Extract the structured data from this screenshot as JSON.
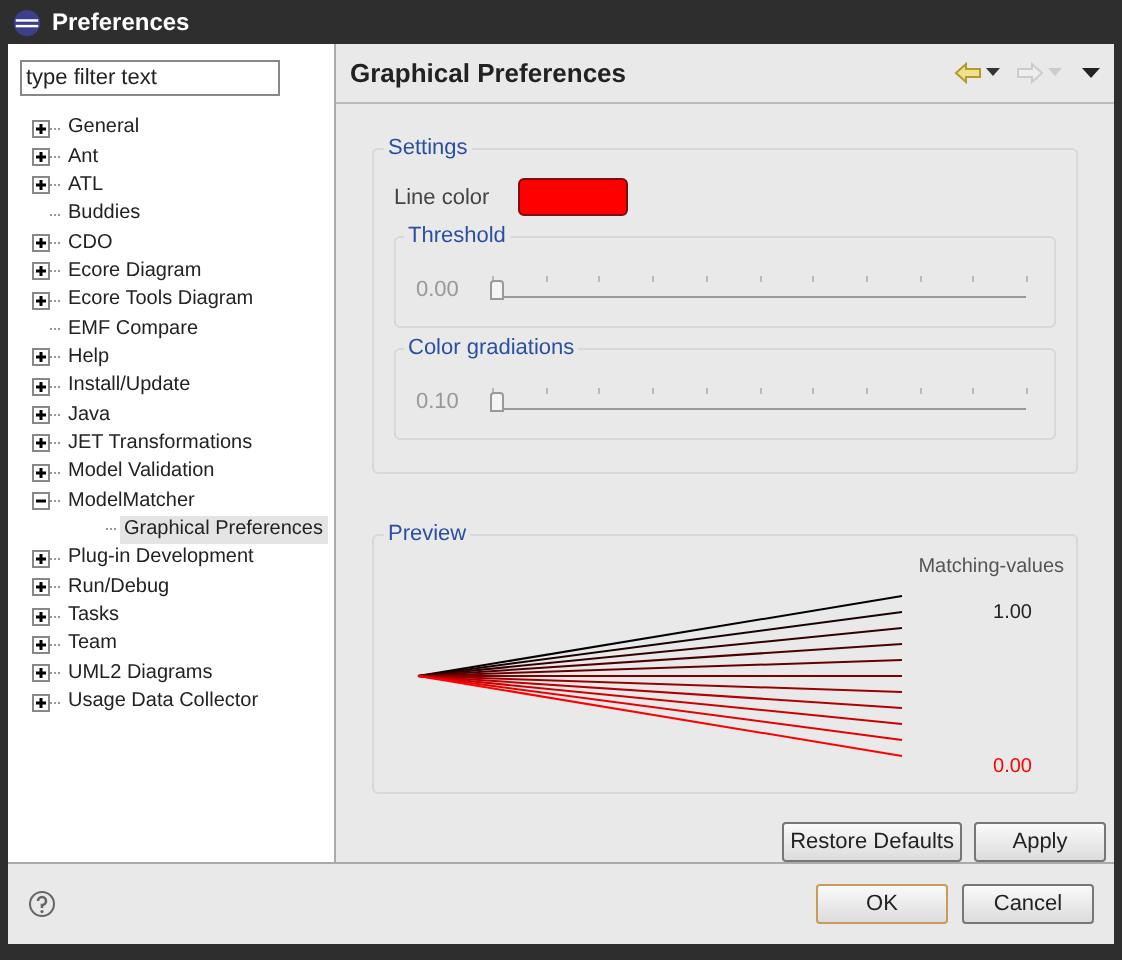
{
  "window": {
    "title": "Preferences"
  },
  "filter": {
    "placeholder": "type filter text"
  },
  "tree": [
    {
      "label": "General",
      "expandable": true,
      "expanded": false,
      "selected": false
    },
    {
      "label": "Ant",
      "expandable": true,
      "expanded": false,
      "selected": false
    },
    {
      "label": "ATL",
      "expandable": true,
      "expanded": false,
      "selected": false
    },
    {
      "label": "Buddies",
      "expandable": false,
      "selected": false
    },
    {
      "label": "CDO",
      "expandable": true,
      "expanded": false,
      "selected": false
    },
    {
      "label": "Ecore Diagram",
      "expandable": true,
      "expanded": false,
      "selected": false
    },
    {
      "label": "Ecore Tools Diagram",
      "expandable": true,
      "expanded": false,
      "selected": false
    },
    {
      "label": "EMF Compare",
      "expandable": false,
      "selected": false
    },
    {
      "label": "Help",
      "expandable": true,
      "expanded": false,
      "selected": false
    },
    {
      "label": "Install/Update",
      "expandable": true,
      "expanded": false,
      "selected": false
    },
    {
      "label": "Java",
      "expandable": true,
      "expanded": false,
      "selected": false
    },
    {
      "label": "JET Transformations",
      "expandable": true,
      "expanded": false,
      "selected": false
    },
    {
      "label": "Model Validation",
      "expandable": true,
      "expanded": false,
      "selected": false
    },
    {
      "label": "ModelMatcher",
      "expandable": true,
      "expanded": true,
      "selected": false,
      "children": [
        {
          "label": "Graphical Preferences",
          "expandable": false,
          "selected": true
        }
      ]
    },
    {
      "label": "Plug-in Development",
      "expandable": true,
      "expanded": false,
      "selected": false
    },
    {
      "label": "Run/Debug",
      "expandable": true,
      "expanded": false,
      "selected": false
    },
    {
      "label": "Tasks",
      "expandable": true,
      "expanded": false,
      "selected": false
    },
    {
      "label": "Team",
      "expandable": true,
      "expanded": false,
      "selected": false
    },
    {
      "label": "UML2 Diagrams",
      "expandable": true,
      "expanded": false,
      "selected": false
    },
    {
      "label": "Usage Data Collector",
      "expandable": true,
      "expanded": false,
      "selected": false
    }
  ],
  "page": {
    "title": "Graphical Preferences",
    "settings": {
      "title": "Settings",
      "line_color": {
        "label": "Line color",
        "color": "#ff0000"
      },
      "sliders": [
        {
          "title": "Threshold",
          "reading": "0.00",
          "level": 0
        },
        {
          "title": "Color gradiations",
          "reading": "0.10",
          "level": 0
        }
      ]
    },
    "preview": {
      "title": "Preview",
      "legend_title": "Matching-values",
      "top_value": "1.00",
      "bottom_value": "0.00"
    },
    "buttons": [
      "Restore Defaults",
      "Apply"
    ]
  },
  "dialog_buttons": [
    {
      "label": "OK",
      "default": true
    },
    {
      "label": "Cancel",
      "default": false
    }
  ]
}
